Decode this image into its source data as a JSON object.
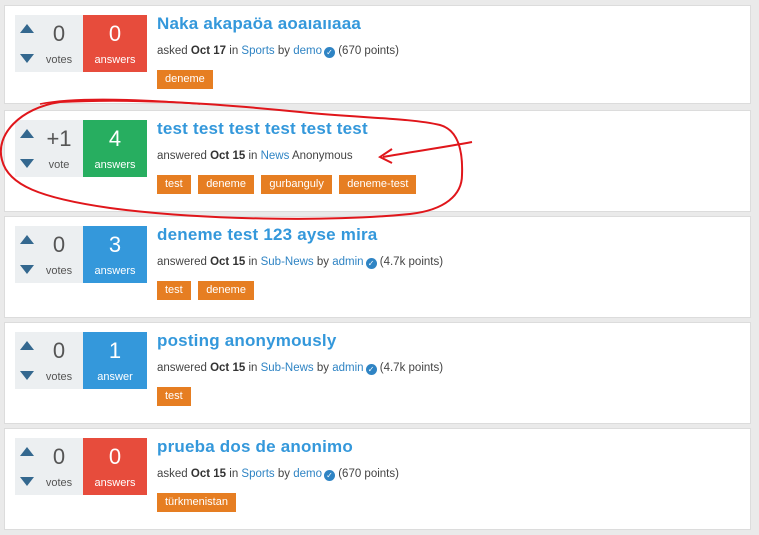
{
  "questions": [
    {
      "votes": "0",
      "vote_label": "votes",
      "answers": "0",
      "answer_label": "answers",
      "title": "Naka akapaöa aoaıaııaaa",
      "action": "asked",
      "date": "Oct 17",
      "in_word": "in",
      "category": "Sports",
      "by_word": "by",
      "user": "demo",
      "points": "(670 points)",
      "tags": [
        "deneme"
      ]
    },
    {
      "votes": "+1",
      "vote_label": "vote",
      "answers": "4",
      "answer_label": "answers",
      "title": "test test test test test test",
      "action": "answered",
      "date": "Oct 15",
      "in_word": "in",
      "category": "News",
      "user": "Anonymous",
      "tags": [
        "test",
        "deneme",
        "gurbanguly",
        "deneme-test"
      ]
    },
    {
      "votes": "0",
      "vote_label": "votes",
      "answers": "3",
      "answer_label": "answers",
      "title": "deneme test 123 ayse mira",
      "action": "answered",
      "date": "Oct 15",
      "in_word": "in",
      "category": "Sub-News",
      "by_word": "by",
      "user": "admin",
      "points": "(4.7k points)",
      "tags": [
        "test",
        "deneme"
      ]
    },
    {
      "votes": "0",
      "vote_label": "votes",
      "answers": "1",
      "answer_label": "answer",
      "title": "posting anonymously",
      "action": "answered",
      "date": "Oct 15",
      "in_word": "in",
      "category": "Sub-News",
      "by_word": "by",
      "user": "admin",
      "points": "(4.7k points)",
      "tags": [
        "test"
      ]
    },
    {
      "votes": "0",
      "vote_label": "votes",
      "answers": "0",
      "answer_label": "answers",
      "title": "prueba dos de anonimo",
      "action": "asked",
      "date": "Oct 15",
      "in_word": "in",
      "category": "Sports",
      "by_word": "by",
      "user": "demo",
      "points": "(670 points)",
      "tags": [
        "türkmenistan"
      ]
    }
  ],
  "colors": {
    "answers_zero": "#e74c3c",
    "answers_accepted": "#27ae60",
    "answers_some": "#3498db",
    "tag": "#e67e22",
    "link": "#3498db",
    "annotation": "#e0161b"
  }
}
